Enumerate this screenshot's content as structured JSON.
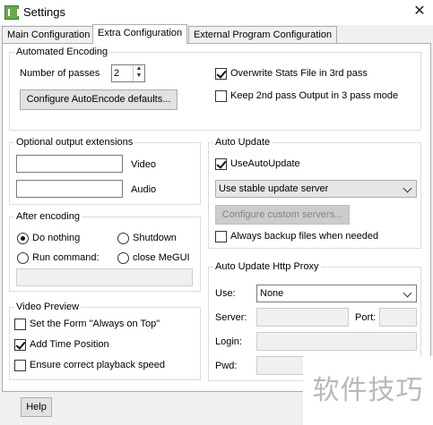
{
  "window": {
    "title": "Settings",
    "app_icon": "megui-icon",
    "close_glyph": "✕"
  },
  "tabs": [
    {
      "label": "Main Configuration",
      "active": false
    },
    {
      "label": "Extra Configuration",
      "active": true
    },
    {
      "label": "External Program Configuration",
      "active": false
    }
  ],
  "automated_encoding": {
    "legend": "Automated Encoding",
    "passes_label": "Number of passes",
    "passes_value": "2",
    "configure_button": "Configure AutoEncode defaults...",
    "overwrite_stats": {
      "label": "Overwrite Stats File in 3rd pass",
      "checked": true
    },
    "keep_2nd_pass": {
      "label": "Keep 2nd pass Output in 3 pass mode",
      "checked": false
    }
  },
  "output_extensions": {
    "legend": "Optional output extensions",
    "video_label": "Video",
    "video_value": "",
    "audio_label": "Audio",
    "audio_value": ""
  },
  "after_encoding": {
    "legend": "After encoding",
    "options": [
      {
        "label": "Do nothing",
        "checked": true
      },
      {
        "label": "Shutdown",
        "checked": false
      },
      {
        "label": "Run command:",
        "checked": false
      },
      {
        "label": "close MeGUI",
        "checked": false
      }
    ],
    "command_value": ""
  },
  "video_preview": {
    "legend": "Video Preview",
    "always_on_top": {
      "label": "Set the Form \"Always on Top\"",
      "checked": false
    },
    "add_time_position": {
      "label": "Add Time Position",
      "checked": true
    },
    "correct_playback": {
      "label": "Ensure correct playback speed",
      "checked": false
    }
  },
  "auto_update": {
    "legend": "Auto Update",
    "use_auto_update": {
      "label": "UseAutoUpdate",
      "checked": true
    },
    "server_select": "Use stable update server",
    "configure_servers_button": "Configure custom servers...",
    "always_backup": {
      "label": "Always backup files when needed",
      "checked": false
    }
  },
  "proxy": {
    "legend": "Auto Update Http Proxy",
    "use_label": "Use:",
    "use_value": "None",
    "server_label": "Server:",
    "port_label": "Port:",
    "login_label": "Login:",
    "pwd_label": "Pwd:"
  },
  "footer": {
    "help_button": "Help"
  },
  "watermark": "软件技巧"
}
